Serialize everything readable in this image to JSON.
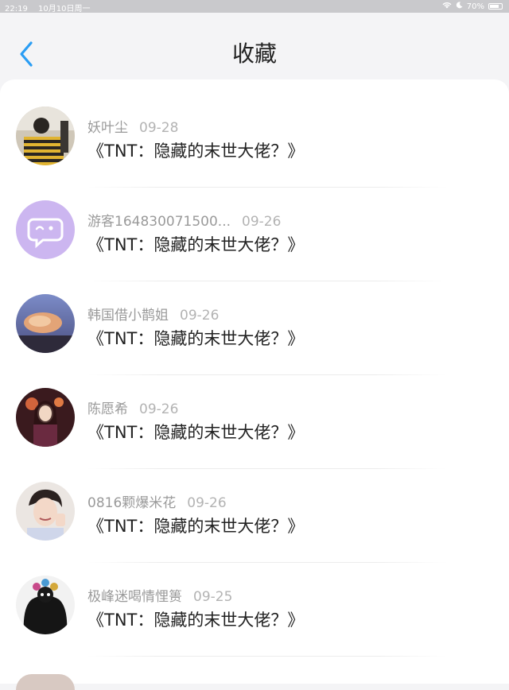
{
  "statusbar": {
    "time": "22:19",
    "date": "10月10日周一",
    "battery": "70%"
  },
  "header": {
    "title": "收藏",
    "back_icon": "chevron-left-icon",
    "accent": "#2a9df4"
  },
  "items": [
    {
      "user": "妖叶尘",
      "date": "09-28",
      "book": "《TNT：隐藏的末世大佬？》"
    },
    {
      "user": "游客164830071500...",
      "date": "09-26",
      "book": "《TNT：隐藏的末世大佬？》"
    },
    {
      "user": "韩国借小鹊姐",
      "date": "09-26",
      "book": "《TNT：隐藏的末世大佬？》"
    },
    {
      "user": "陈愿希",
      "date": "09-26",
      "book": "《TNT：隐藏的末世大佬？》"
    },
    {
      "user": "0816颗爆米花",
      "date": "09-26",
      "book": "《TNT：隐藏的末世大佬？》"
    },
    {
      "user": "极峰迷喝情悝篑",
      "date": "09-25",
      "book": "《TNT：隐藏的末世大佬？》"
    }
  ]
}
